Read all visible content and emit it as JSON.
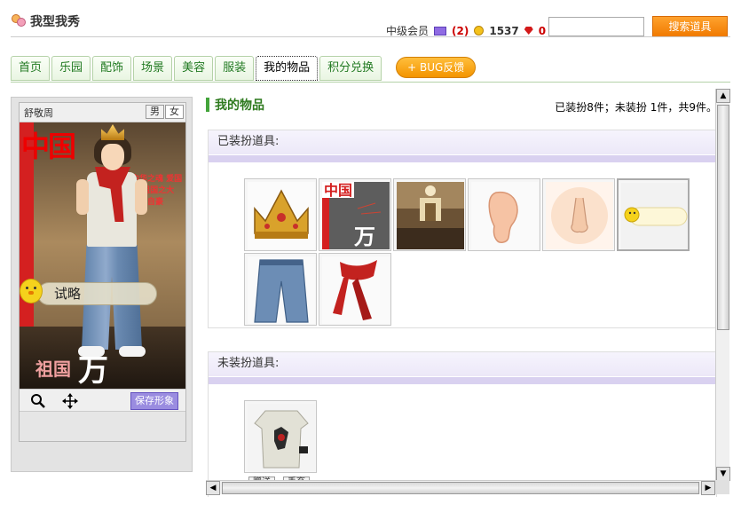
{
  "header": {
    "title": "我型我秀",
    "member_level": "中级会员",
    "member_count": "(2)",
    "coins": "1537",
    "gems": "0",
    "search_placeholder": "",
    "search_button": "搜索道具"
  },
  "tabs": [
    {
      "label": "首页"
    },
    {
      "label": "乐园"
    },
    {
      "label": "配饰"
    },
    {
      "label": "场景"
    },
    {
      "label": "美容"
    },
    {
      "label": "服装"
    },
    {
      "label": "我的物品",
      "active": true
    },
    {
      "label": "积分兑换"
    }
  ],
  "bug_button": "+ BUG反馈",
  "avatar": {
    "user_name": "舒敬周",
    "gender_male": "男",
    "gender_female": "女",
    "stage_text": "中国",
    "slogan": "中华之魂 爱国者 祖国之大 我为自豪",
    "wan_char": "万",
    "wan_left": "祖国",
    "bubble_text": "试略",
    "save_button": "保存形象",
    "zoom_icon": "magnifier-icon",
    "move_icon": "move-arrows-icon"
  },
  "main": {
    "title": "我的物品",
    "summary": "已装扮8件；未装扮 1件，共9件。",
    "equipped_header": "已装扮道具:",
    "unequipped_header": "未装扮道具:",
    "equipped_items": [
      {
        "name": "crown"
      },
      {
        "name": "china-background"
      },
      {
        "name": "church-scene"
      },
      {
        "name": "ear"
      },
      {
        "name": "nose"
      },
      {
        "name": "chick-bubble",
        "selected": true
      },
      {
        "name": "jeans"
      },
      {
        "name": "red-scarf"
      }
    ],
    "unequipped_items": [
      {
        "name": "graphic-tshirt"
      }
    ],
    "item_actions": [
      "赠送",
      "丢弃"
    ]
  }
}
